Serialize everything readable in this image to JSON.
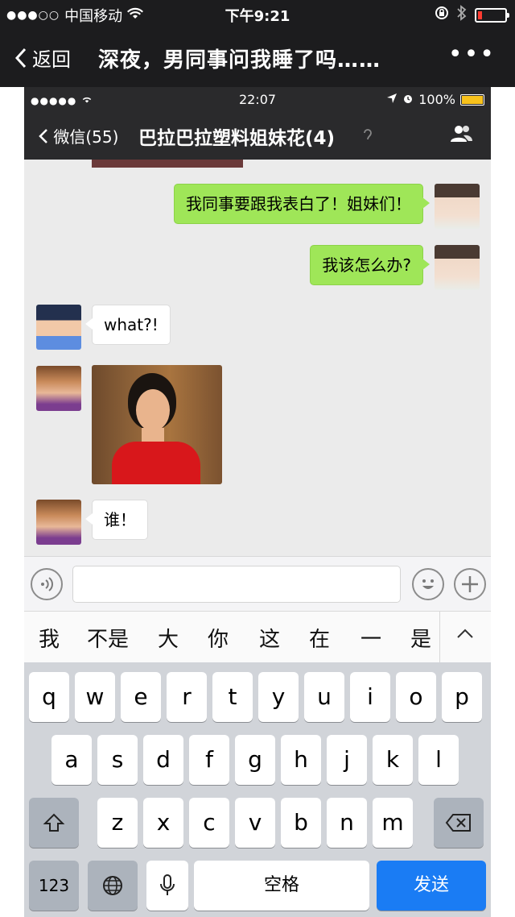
{
  "outer_status": {
    "carrier": "中国移动",
    "time": "下午9:21"
  },
  "outer_nav": {
    "back_label": "返回",
    "title": "深夜，男同事问我睡了吗……",
    "more_label": "•••"
  },
  "inner_status": {
    "time": "22:07",
    "battery": "100%"
  },
  "inner_nav": {
    "back_label": "微信(55)",
    "title": "巴拉巴拉塑料姐妹花(4)"
  },
  "messages": [
    {
      "side": "right",
      "text": "我同事要跟我表白了！姐妹们！"
    },
    {
      "side": "right",
      "text": "我该怎么办?"
    },
    {
      "side": "left",
      "text": "what?!"
    },
    {
      "side": "left",
      "type": "image"
    },
    {
      "side": "left",
      "text": "谁！"
    }
  ],
  "candidates": [
    "我",
    "不是",
    "大",
    "你",
    "这",
    "在",
    "一",
    "是"
  ],
  "keyboard": {
    "row1": [
      "q",
      "w",
      "e",
      "r",
      "t",
      "y",
      "u",
      "i",
      "o",
      "p"
    ],
    "row2": [
      "a",
      "s",
      "d",
      "f",
      "g",
      "h",
      "j",
      "k",
      "l"
    ],
    "row3": [
      "z",
      "x",
      "c",
      "v",
      "b",
      "n",
      "m"
    ],
    "numbers_label": "123",
    "space_label": "空格",
    "send_label": "发送"
  },
  "colors": {
    "bubble_green": "#9fe658",
    "send_blue": "#1a7cf4",
    "header_dark": "#1c1c1e"
  }
}
